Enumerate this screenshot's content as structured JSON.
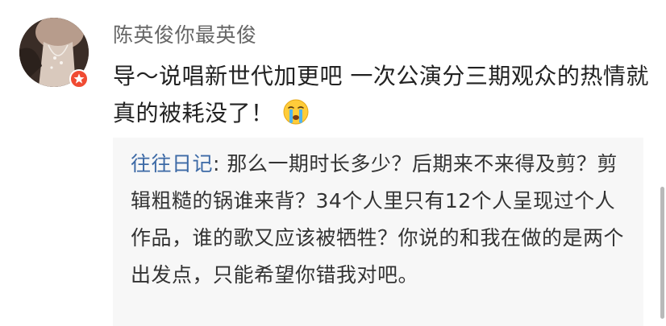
{
  "comment": {
    "username": "陈英俊你最英俊",
    "text": "导～说唱新世代加更吧 一次公演分三期观众的热情就真的被耗没了！",
    "emoji": "crying-face-icon",
    "verified_badge_color": "#f04b32"
  },
  "reply": {
    "author": "往往日记",
    "separator": ": ",
    "text": "那么一期时长多少？后期来不来得及剪？剪辑粗糙的锅谁来背？34个人里只有12个人呈现过个人作品，谁的歌又应该被牺牲？你说的和我在做的是两个出发点，只能希望你错我对吧。",
    "author_color": "#3d6aa6"
  }
}
